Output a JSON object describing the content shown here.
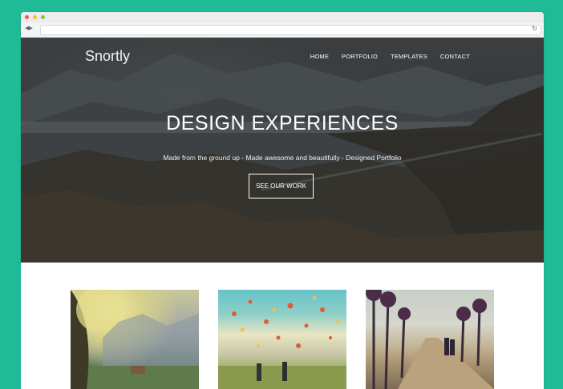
{
  "browser": {
    "back_glyph": "◀",
    "forward_glyph": "▶",
    "reload_glyph": "↻"
  },
  "site": {
    "brand": "Snortly",
    "nav": [
      "HOME",
      "PORTFOLIO",
      "TEMPLATES",
      "CONTACT"
    ],
    "hero_title": "DESIGN EXPERIENCES",
    "hero_subtitle": "Made from the ground up - Made awesome and beautifully - Designed Portfolio",
    "cta_label": "SEE OUR WORK"
  },
  "colors": {
    "background": "#1fba96",
    "hero_overlay": "#2d2d2d"
  }
}
